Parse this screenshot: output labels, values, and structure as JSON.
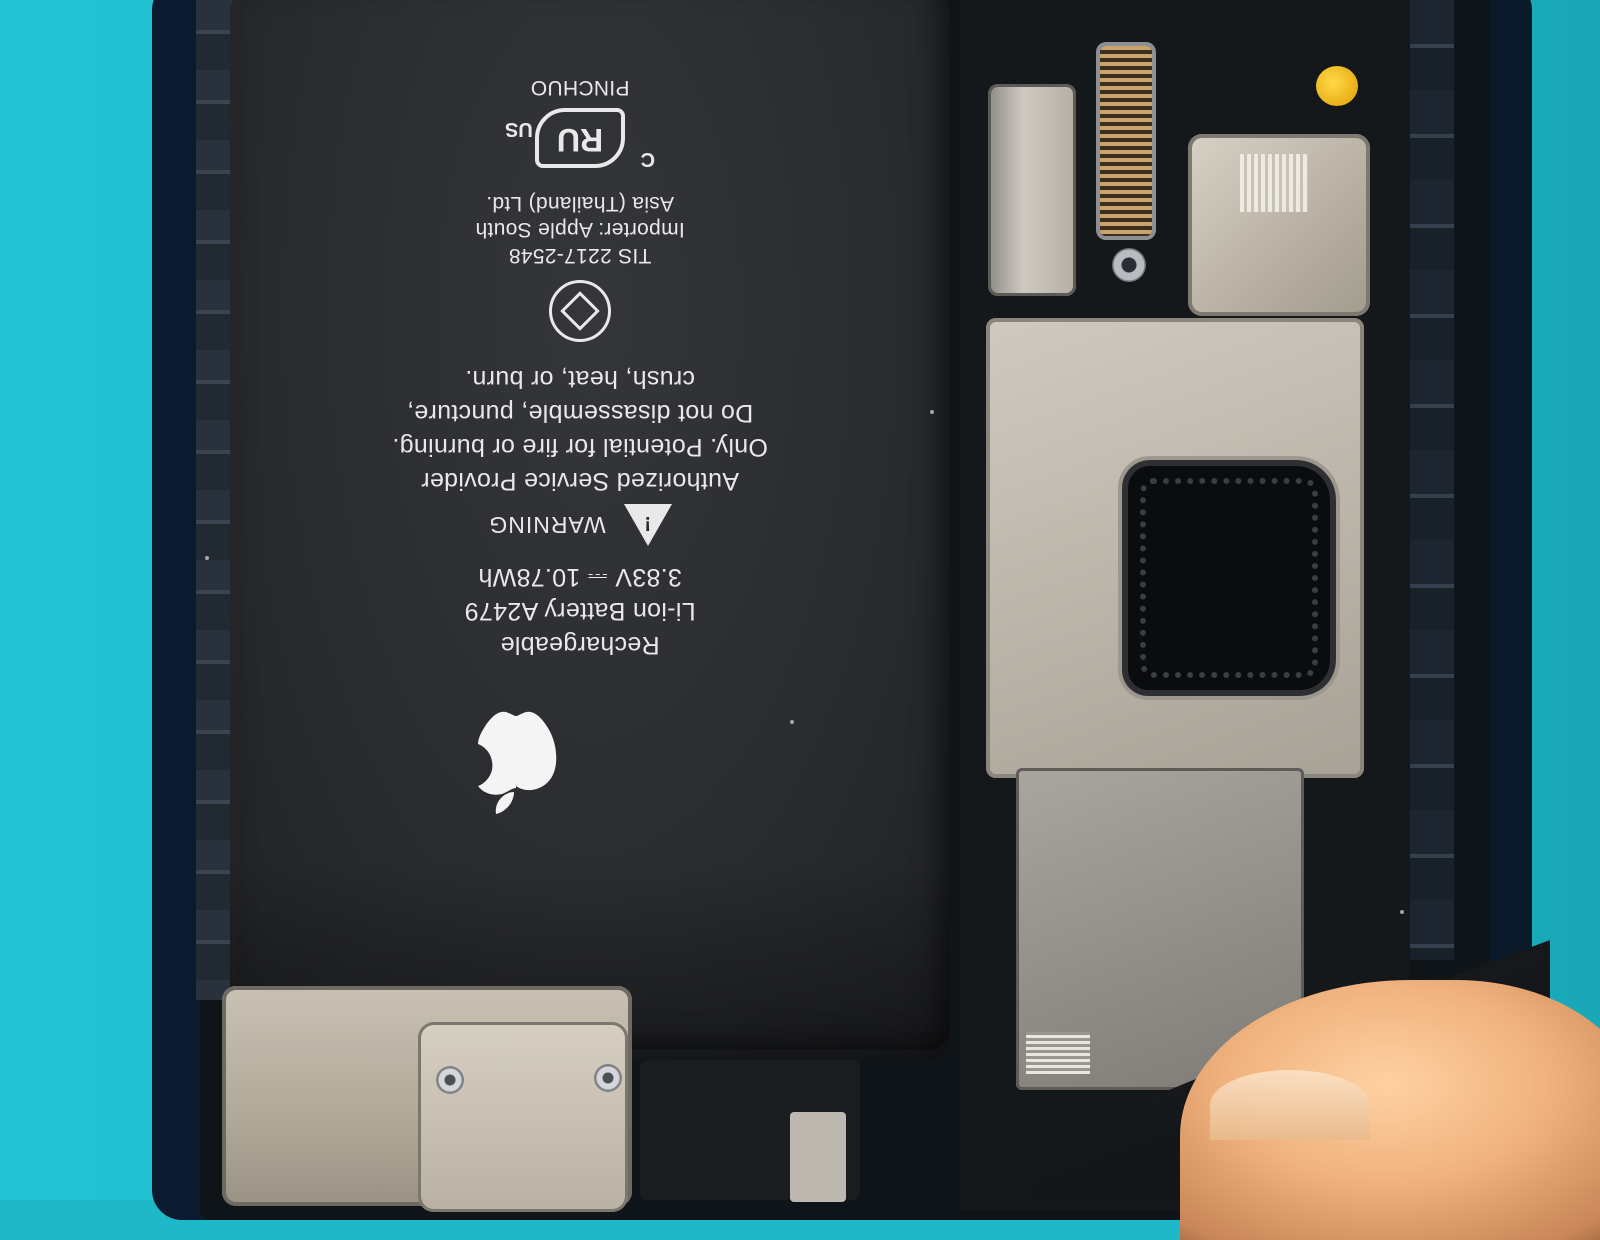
{
  "battery_label": {
    "line1": "Rechargeable",
    "line2": "Li-ion Battery A2479",
    "line3": "3.83V ⎓ 10.78Wh",
    "warning_title": "WARNING",
    "warning_line1": "Authorized Service Provider",
    "warning_line2": "Only. Potential for fire or burning.",
    "warning_line3": "Do not disassemble, puncture,",
    "warning_line4": "crush, heat, or burn.",
    "tis_line": "TIS 2217-2548",
    "importer_line1": "Importer: Apple South",
    "importer_line2": "Asia (Thailand) Ltd.",
    "cert_c": "C",
    "cert_us": "US",
    "manufacturer": "PINCHUO"
  },
  "icons": [
    "apple-logo-icon",
    "warning-triangle-icon",
    "recycle-symbol-icon",
    "ul-certification-logo"
  ],
  "colors": {
    "background_mat": "#1fb8c8",
    "battery_wrap": "#2a2c30",
    "label_text": "#e9e9e9",
    "shield_metal": "#bdb6ab",
    "accent_gold": "#e0a000"
  }
}
